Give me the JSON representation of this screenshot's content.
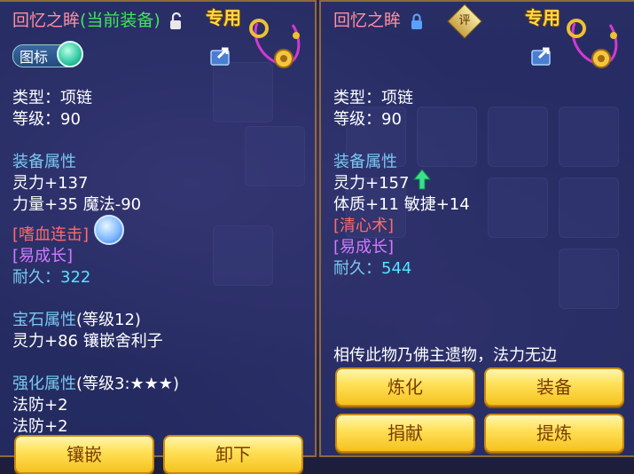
{
  "left": {
    "title": "回忆之眸",
    "equipped_tag": "(当前装备)",
    "special": "专用",
    "icon_toggle_label": "图标",
    "type": "类型：项链",
    "level": "等级：90",
    "equip_attr_header": "装备属性",
    "stat1": "灵力+137",
    "stat2": "力量+35 魔法-90",
    "special_skill": "[嗜血连击]",
    "effect": "[易成长]",
    "durability_label": "耐久：",
    "durability_value": "322",
    "gem_header": "宝石属性",
    "gem_level": "(等级12)",
    "gem_stat": "灵力+86 镶嵌舍利子",
    "enhance_header": "强化属性",
    "enhance_level": "(等级3:★★★)",
    "enhance1": "法防+2",
    "enhance2": "法防+2",
    "btn_inlay": "镶嵌",
    "btn_unequip": "卸下"
  },
  "right": {
    "title": "回忆之眸",
    "appraise": "评",
    "special": "专用",
    "type": "类型：项链",
    "level": "等级：90",
    "equip_attr_header": "装备属性",
    "stat1": "灵力+157",
    "stat2": "体质+11 敏捷+14",
    "special_skill": "[清心术]",
    "effect": "[易成长]",
    "durability_label": "耐久：",
    "durability_value": "544",
    "description": "相传此物乃佛主遗物，法力无边",
    "btn_refine": "炼化",
    "btn_equip": "装备",
    "btn_donate": "捐献",
    "btn_purify": "提炼"
  },
  "icons": [
    "unlock-icon",
    "lock-icon",
    "share-icon",
    "necklace-icon",
    "spin-icon",
    "up-arrow-icon",
    "appraise-icon"
  ],
  "colors": {
    "title": "#ff8fa0",
    "equipped": "#3ee65a",
    "section": "#7ac8f0",
    "skill": "#ff6a6a",
    "effect": "#d27aff",
    "durability": "#4ee6ff",
    "button": "#ffe15a"
  }
}
